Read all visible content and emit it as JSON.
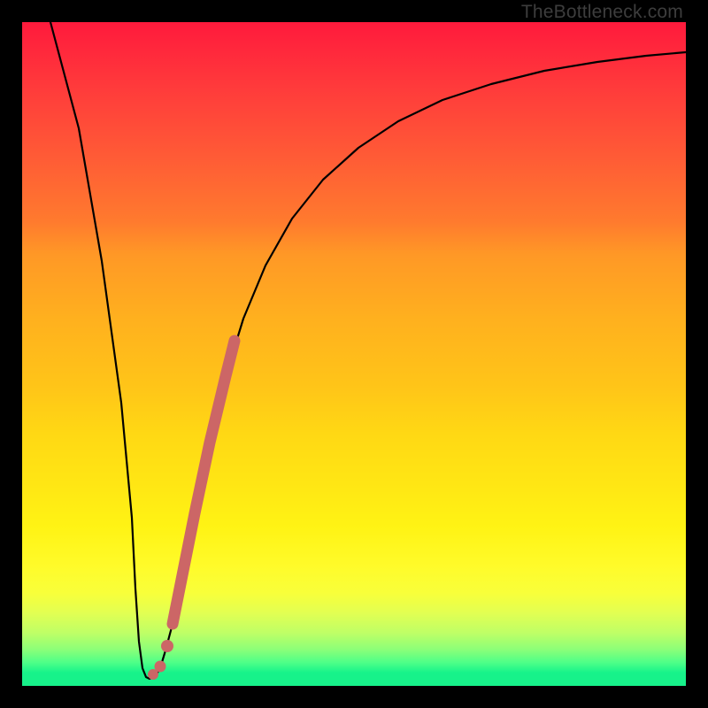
{
  "watermark": "TheBottleneck.com",
  "chart_data": {
    "type": "line",
    "title": "",
    "xlabel": "",
    "ylabel": "",
    "xlim": [
      0,
      100
    ],
    "ylim": [
      0,
      100
    ],
    "series": [
      {
        "name": "bottleneck-curve",
        "x": [
          2,
          4,
          6,
          8,
          10,
          12,
          14,
          16,
          18,
          20,
          22,
          24,
          26,
          28,
          30,
          33,
          36,
          40,
          45,
          50,
          56,
          63,
          72,
          82,
          92,
          100
        ],
        "y": [
          100,
          88,
          76,
          63,
          50,
          35,
          13,
          4,
          3,
          7,
          18,
          30,
          41,
          50,
          57,
          64,
          70,
          75,
          80,
          83.5,
          86.5,
          89,
          91.2,
          92.8,
          93.8,
          94.5
        ]
      },
      {
        "name": "highlight-segment",
        "x": [
          17.5,
          18.5,
          20,
          22,
          24,
          26,
          28,
          30,
          31.5
        ],
        "y": [
          4,
          4,
          7,
          18,
          30,
          41,
          50,
          57,
          61
        ]
      }
    ],
    "colors": {
      "curve": "#000000",
      "highlight": "#cc6666",
      "gradient_top": "#ff1a3c",
      "gradient_bottom": "#17f08a"
    }
  }
}
